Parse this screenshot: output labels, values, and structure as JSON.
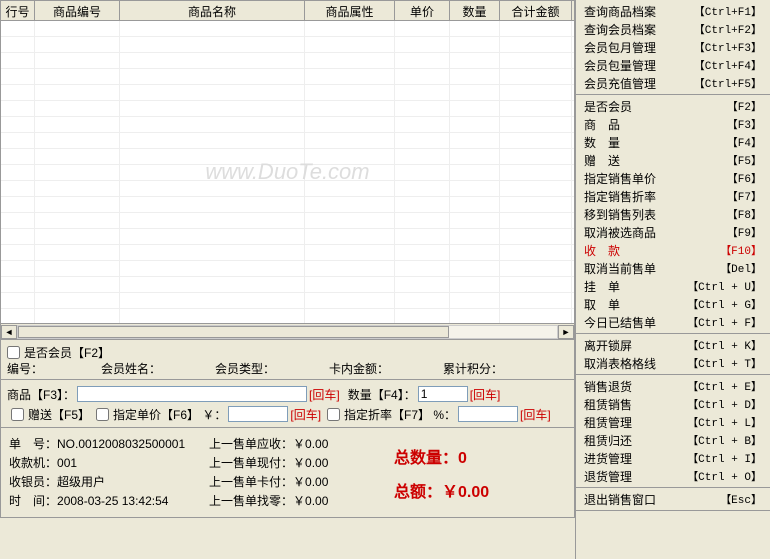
{
  "grid": {
    "headers": [
      "行号",
      "商品编号",
      "商品名称",
      "商品属性",
      "单价",
      "数量",
      "合计金额"
    ]
  },
  "watermark": "www.DuoTe.com",
  "member": {
    "checkbox_label": "是否会员【F2】",
    "id_label": "编号：",
    "name_label": "会员姓名：",
    "type_label": "会员类型：",
    "balance_label": "卡内金额：",
    "points_label": "累计积分："
  },
  "product": {
    "code_label": "商品【F3】：",
    "enter_label": "[回车]",
    "qty_label": "数量【F4】：",
    "qty_value": "1",
    "gift_label": "赠送【F5】",
    "price_label": "指定单价【F6】 ￥：",
    "discount_label": "指定折率【F7】 %："
  },
  "status": {
    "order_no_label": "单　号：",
    "order_no": "NO.0012008032500001",
    "machine_label": "收款机：",
    "machine": "001",
    "cashier_label": "收银员：",
    "cashier": "超级用户",
    "time_label": "时　间：",
    "time": "2008-03-25 13:42:54",
    "last_recv_label": "上一售单应收：",
    "last_recv": "￥0.00",
    "last_cash_label": "上一售单现付：",
    "last_cash": "￥0.00",
    "last_card_label": "上一售单卡付：",
    "last_card": "￥0.00",
    "last_change_label": "上一售单找零：",
    "last_change": "￥0.00",
    "total_qty_label": "总数量：",
    "total_qty": "0",
    "total_amt_label": "总额：",
    "total_amt": "￥0.00"
  },
  "menu": {
    "sec1": [
      {
        "label": "查询商品档案",
        "key": "【Ctrl+F1】"
      },
      {
        "label": "查询会员档案",
        "key": "【Ctrl+F2】"
      },
      {
        "label": "会员包月管理",
        "key": "【Ctrl+F3】"
      },
      {
        "label": "会员包量管理",
        "key": "【Ctrl+F4】"
      },
      {
        "label": "会员充值管理",
        "key": "【Ctrl+F5】"
      }
    ],
    "sec2": [
      {
        "label": "是否会员",
        "key": "【F2】"
      },
      {
        "label": "商　品",
        "key": "【F3】"
      },
      {
        "label": "数　量",
        "key": "【F4】"
      },
      {
        "label": "赠　送",
        "key": "【F5】"
      },
      {
        "label": "指定销售单价",
        "key": "【F6】"
      },
      {
        "label": "指定销售折率",
        "key": "【F7】"
      },
      {
        "label": "移到销售列表",
        "key": "【F8】"
      },
      {
        "label": "取消被选商品",
        "key": "【F9】"
      },
      {
        "label": "收　款",
        "key": "【F10】",
        "red": true
      },
      {
        "label": "取消当前售单",
        "key": "【Del】"
      },
      {
        "label": "挂　单",
        "key": "【Ctrl + U】"
      },
      {
        "label": "取　单",
        "key": "【Ctrl + G】"
      },
      {
        "label": "今日已结售单",
        "key": "【Ctrl + F】"
      }
    ],
    "sec3": [
      {
        "label": "离开锁屏",
        "key": "【Ctrl + K】"
      },
      {
        "label": "取消表格格线",
        "key": "【Ctrl + T】"
      }
    ],
    "sec4": [
      {
        "label": "销售退货",
        "key": "【Ctrl + E】"
      },
      {
        "label": "租赁销售",
        "key": "【Ctrl + D】"
      },
      {
        "label": "租赁管理",
        "key": "【Ctrl + L】"
      },
      {
        "label": "租赁归还",
        "key": "【Ctrl + B】"
      },
      {
        "label": "进货管理",
        "key": "【Ctrl + I】"
      },
      {
        "label": "退货管理",
        "key": "【Ctrl + O】"
      }
    ],
    "sec5": [
      {
        "label": "退出销售窗口",
        "key": "【Esc】"
      }
    ]
  }
}
